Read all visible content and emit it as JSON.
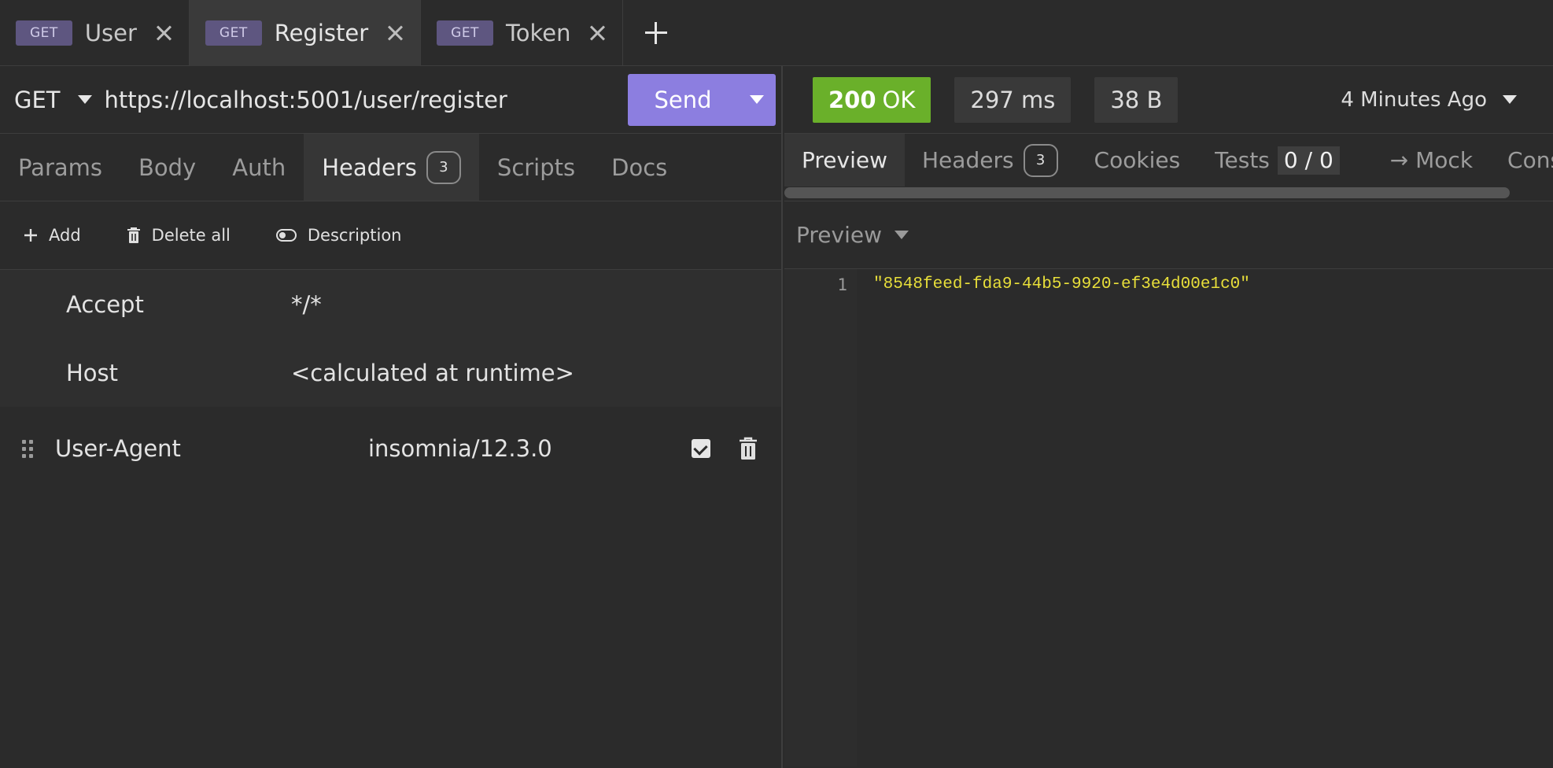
{
  "tabs": [
    {
      "method": "GET",
      "name": "User"
    },
    {
      "method": "GET",
      "name": "Register"
    },
    {
      "method": "GET",
      "name": "Token"
    }
  ],
  "request": {
    "method": "GET",
    "url": "https://localhost:5001/user/register",
    "send_label": "Send",
    "tabs": [
      "Params",
      "Body",
      "Auth",
      "Headers",
      "Scripts",
      "Docs"
    ],
    "headers_count": "3",
    "toolbar": {
      "add": "Add",
      "delete_all": "Delete all",
      "description": "Description"
    },
    "readonly_headers": [
      {
        "key": "Accept",
        "value": "*/*"
      },
      {
        "key": "Host",
        "value": "<calculated at runtime>"
      }
    ],
    "editable_header": {
      "key": "User-Agent",
      "value": "insomnia/12.3.0"
    }
  },
  "response": {
    "status_code": "200",
    "status_text": "OK",
    "time": "297 ms",
    "size": "38 B",
    "ago": "4 Minutes Ago",
    "tabs": {
      "preview": "Preview",
      "headers": "Headers",
      "headers_count": "3",
      "cookies": "Cookies",
      "tests": "Tests",
      "tests_score": "0 / 0",
      "mock": "→ Mock",
      "console": "Console"
    },
    "preview_mode": "Preview",
    "line_number": "1",
    "body": "\"8548feed-fda9-44b5-9920-ef3e4d00e1c0\""
  },
  "colors": {
    "accent": "#8c7ee0",
    "ok": "#6ab02a",
    "code": "#e8df3a",
    "method_badge": "#5e5680"
  }
}
